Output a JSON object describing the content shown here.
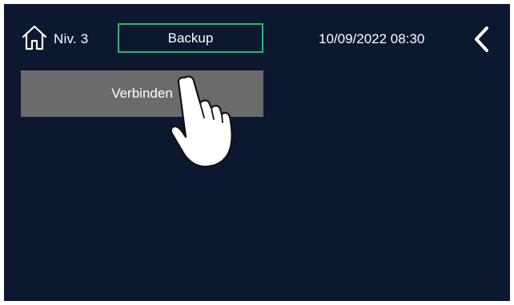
{
  "header": {
    "level_label": "Niv. 3",
    "title": "Backup",
    "datetime": "10/09/2022 08:30"
  },
  "main": {
    "connect_button_label": "Verbinden"
  },
  "icons": {
    "home": "home-icon",
    "back": "chevron-left-icon",
    "pointer": "hand-pointer-icon"
  },
  "colors": {
    "background": "#0b1830",
    "accent_border": "#2fb37a",
    "button_bg": "#6b6b6b",
    "text": "#ffffff"
  }
}
